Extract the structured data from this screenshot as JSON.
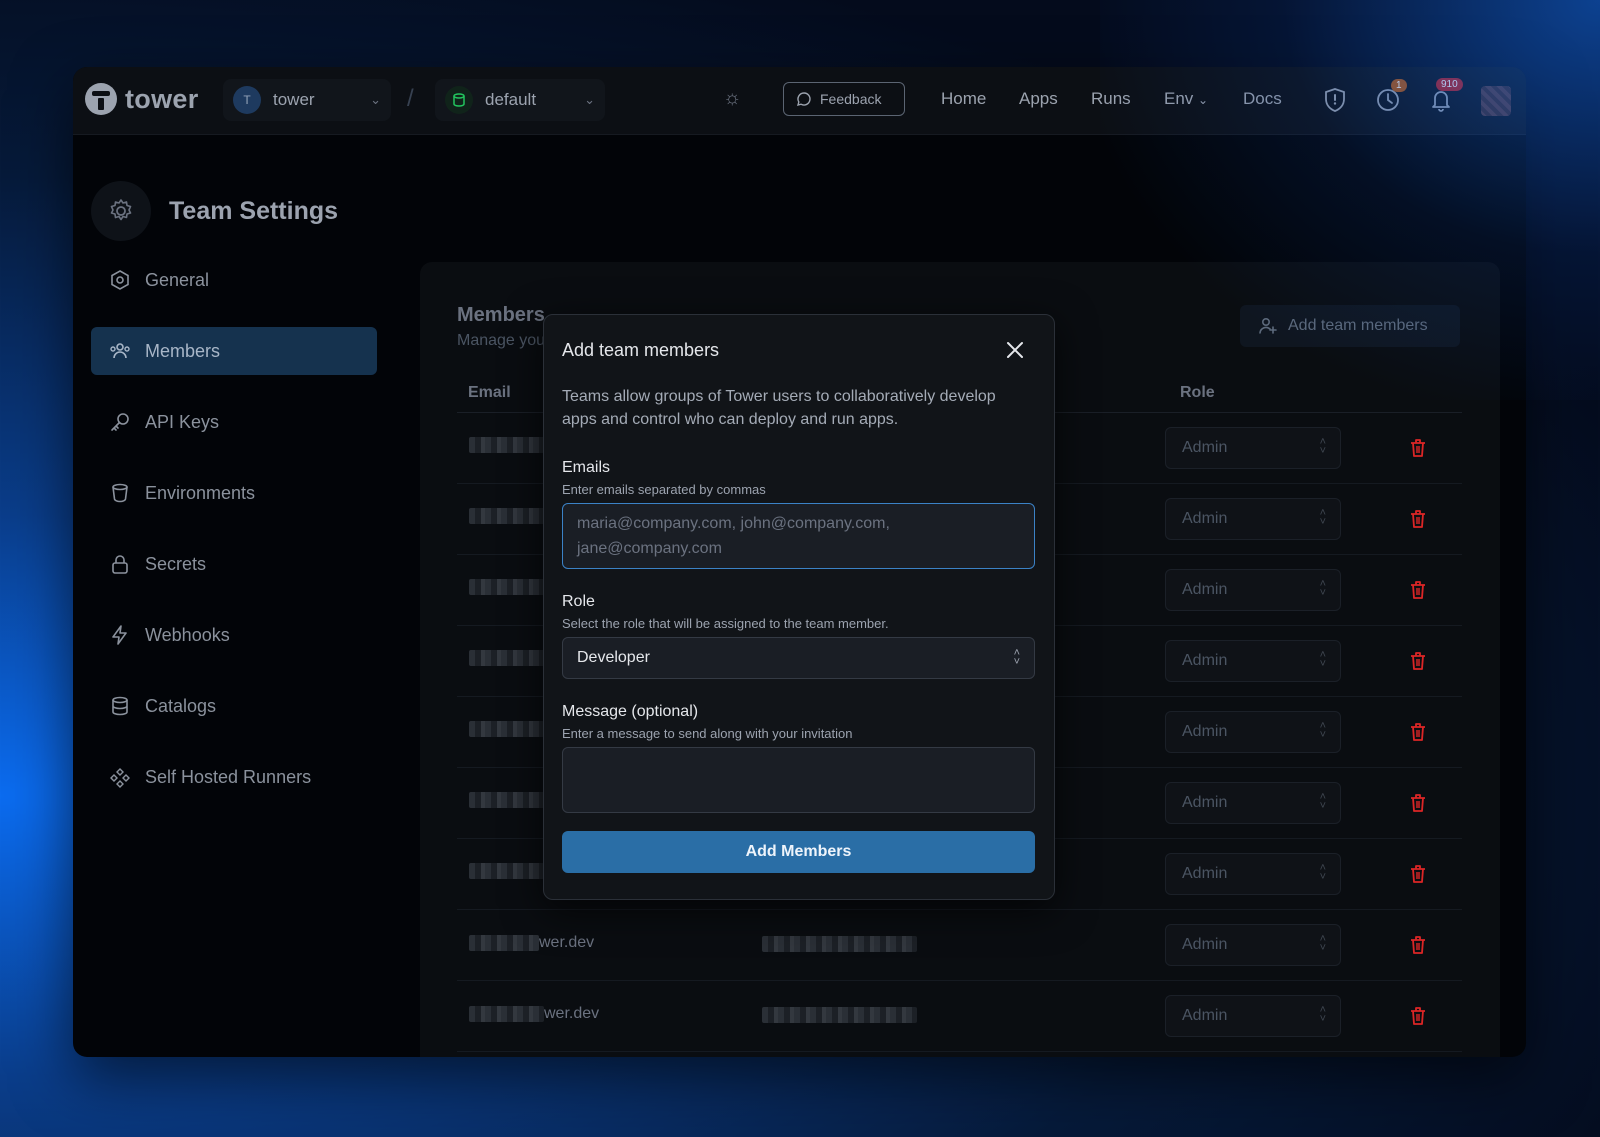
{
  "topnav": {
    "logo_text": "tower",
    "team": {
      "initial": "T",
      "name": "tower"
    },
    "env": {
      "name": "default"
    },
    "feedback_label": "Feedback",
    "links": {
      "home": "Home",
      "apps": "Apps",
      "runs": "Runs",
      "env": "Env",
      "docs": "Docs"
    },
    "clock_badge": "1",
    "bell_badge": "910"
  },
  "page": {
    "title": "Team Settings"
  },
  "sidebar": {
    "items": [
      {
        "label": "General"
      },
      {
        "label": "Members",
        "active": true
      },
      {
        "label": "API Keys"
      },
      {
        "label": "Environments"
      },
      {
        "label": "Secrets"
      },
      {
        "label": "Webhooks"
      },
      {
        "label": "Catalogs"
      },
      {
        "label": "Self Hosted Runners"
      }
    ]
  },
  "members": {
    "title": "Members",
    "subtitle": "Manage you",
    "add_button": "Add team members",
    "columns": {
      "email": "Email",
      "role": "Role"
    },
    "rows": [
      {
        "email_suffix": "",
        "role": "Admin"
      },
      {
        "email_suffix": "",
        "role": "Admin"
      },
      {
        "email_suffix": "",
        "role": "Admin"
      },
      {
        "email_suffix": "",
        "role": "Admin"
      },
      {
        "email_suffix": "",
        "role": "Admin"
      },
      {
        "email_suffix": "",
        "role": "Admin"
      },
      {
        "email_suffix": "",
        "role": "Admin"
      },
      {
        "email_suffix": "wer.dev",
        "role": "Admin"
      },
      {
        "email_suffix": "wer.dev",
        "role": "Admin"
      }
    ]
  },
  "modal": {
    "title": "Add team members",
    "description": "Teams allow groups of Tower users to collaboratively develop apps and control who can deploy and run apps.",
    "emails_label": "Emails",
    "emails_hint": "Enter emails separated by commas",
    "emails_placeholder": "maria@company.com, john@company.com, jane@company.com",
    "role_label": "Role",
    "role_hint": "Select the role that will be assigned to the team member.",
    "role_value": "Developer",
    "message_label": "Message (optional)",
    "message_hint": "Enter a message to send along with your invitation",
    "submit_label": "Add Members"
  }
}
